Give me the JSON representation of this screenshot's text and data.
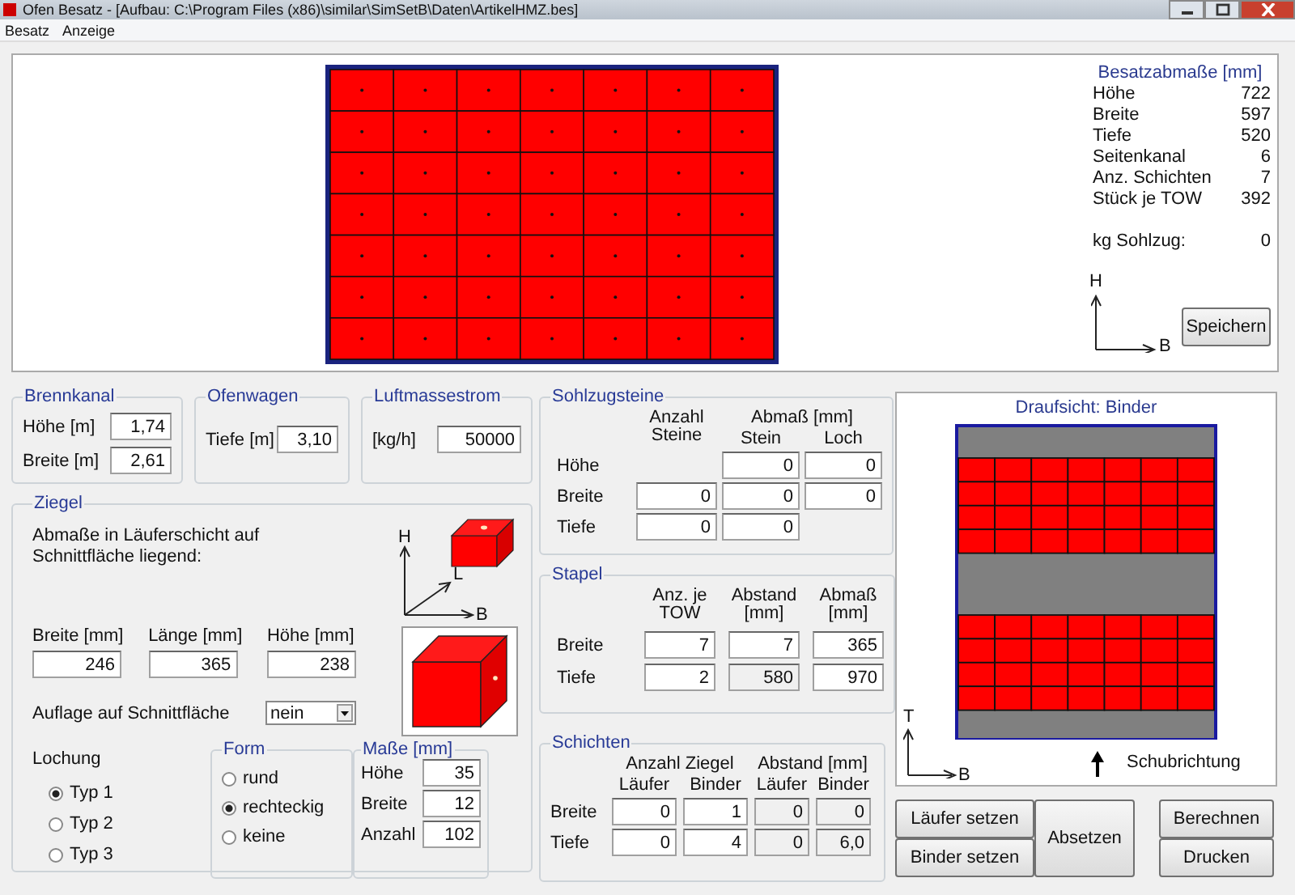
{
  "window": {
    "title": "Ofen Besatz - [Aufbau:  C:\\Program Files (x86)\\similar\\SimSetB\\Daten\\ArtikelHMZ.bes]"
  },
  "menu": [
    "Besatz",
    "Anzeige"
  ],
  "summary": {
    "title": "Besatzabmaße [mm]",
    "rows": [
      {
        "label": "Höhe",
        "value": "722"
      },
      {
        "label": "Breite",
        "value": "597"
      },
      {
        "label": "Tiefe",
        "value": "520"
      },
      {
        "label": "Seitenkanal",
        "value": "6"
      },
      {
        "label": "Anz. Schichten",
        "value": "7"
      },
      {
        "label": "Stück je TOW",
        "value": "392"
      }
    ],
    "weight": {
      "label": "kg Sohlzug:",
      "value": "0"
    },
    "axes": {
      "vertical": "H",
      "horizontal": "B"
    },
    "save_button": "Speichern"
  },
  "top_groups": [
    {
      "title": "Brennkanal",
      "fields": [
        {
          "label": "Höhe [m]",
          "value": "1,74"
        },
        {
          "label": "Breite [m]",
          "value": "2,61"
        }
      ]
    },
    {
      "title": "Ofenwagen",
      "fields": [
        {
          "label": "Tiefe [m]",
          "value": "3,10"
        }
      ]
    },
    {
      "title": "Luftmassestrom",
      "fields": [
        {
          "label": "[kg/h]",
          "value": "50000"
        }
      ]
    }
  ],
  "ziegel": {
    "title": "Ziegel",
    "note": "Abmaße in Läuferschicht auf Schnittfläche liegend:",
    "axes": {
      "height": "H",
      "length": "L",
      "width": "B"
    },
    "fields": [
      {
        "label": "Breite [mm]",
        "value": "246"
      },
      {
        "label": "Länge [mm]",
        "value": "365"
      },
      {
        "label": "Höhe [mm]",
        "value": "238"
      }
    ],
    "support": {
      "label": "Auflage auf Schnittfläche",
      "value": "nein"
    },
    "perforation": {
      "label": "Lochung",
      "options": [
        {
          "label": "Typ 1",
          "selected": true
        },
        {
          "label": "Typ 2",
          "selected": false
        },
        {
          "label": "Typ 3",
          "selected": false
        }
      ]
    },
    "shape": {
      "title": "Form",
      "options": [
        {
          "label": "rund",
          "selected": false
        },
        {
          "label": "rechteckig",
          "selected": true
        },
        {
          "label": "keine",
          "selected": false
        }
      ]
    },
    "hole_size": {
      "title": "Maße [mm]",
      "fields": [
        {
          "label": "Höhe",
          "value": "35"
        },
        {
          "label": "Breite",
          "value": "12"
        },
        {
          "label": "Anzahl",
          "value": "102"
        }
      ]
    }
  },
  "sohlzugsteine": {
    "title": "Sohlzugsteine",
    "count_header": "Anzahl Steine",
    "size_header": "Abmaß [mm]",
    "sub_headers": [
      "Stein",
      "Loch"
    ],
    "rows": [
      {
        "label": "Höhe",
        "stone": "0",
        "hole": "0"
      },
      {
        "label": "Breite",
        "count": "0",
        "stone": "0",
        "hole": "0"
      },
      {
        "label": "Tiefe",
        "count": "0",
        "stone": "0"
      }
    ]
  },
  "stapel": {
    "title": "Stapel",
    "headers": [
      "Anz. je TOW",
      "Abstand [mm]",
      "Abmaß [mm]"
    ],
    "rows": [
      {
        "label": "Breite",
        "cells": [
          {
            "value": "7",
            "disabled": false
          },
          {
            "value": "7",
            "disabled": false
          },
          {
            "value": "365",
            "disabled": false
          }
        ]
      },
      {
        "label": "Tiefe",
        "cells": [
          {
            "value": "2",
            "disabled": false
          },
          {
            "value": "580",
            "disabled": true
          },
          {
            "value": "970",
            "disabled": false
          }
        ]
      }
    ]
  },
  "schichten": {
    "title": "Schichten",
    "group_headers": [
      "Anzahl Ziegel",
      "Abstand [mm]"
    ],
    "sub_headers": [
      "Läufer",
      "Binder",
      "Läufer",
      "Binder"
    ],
    "rows": [
      {
        "label": "Breite",
        "cells": [
          {
            "value": "0",
            "disabled": false
          },
          {
            "value": "1",
            "disabled": false
          },
          {
            "value": "0",
            "disabled": true
          },
          {
            "value": "0",
            "disabled": true
          }
        ]
      },
      {
        "label": "Tiefe",
        "cells": [
          {
            "value": "0",
            "disabled": false
          },
          {
            "value": "4",
            "disabled": false
          },
          {
            "value": "0",
            "disabled": true
          },
          {
            "value": "6,0",
            "disabled": true
          }
        ]
      }
    ]
  },
  "plan": {
    "title": "Draufsicht: Binder",
    "axes": {
      "vertical": "T",
      "horizontal": "B"
    },
    "direction": "Schubrichtung"
  },
  "buttons": {
    "left": [
      "Läufer setzen",
      "Binder setzen"
    ],
    "center": "Absetzen",
    "right": [
      "Berechnen",
      "Drucken"
    ]
  }
}
